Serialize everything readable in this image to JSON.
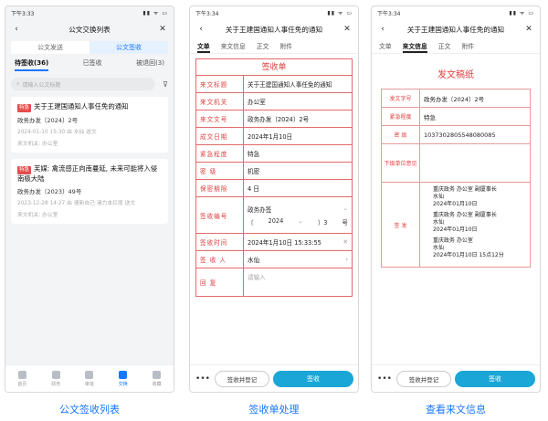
{
  "status": {
    "time_p1": "下午3:33",
    "time_p2": "下午3:34",
    "time_p3": "下午3:34",
    "signal": "▮▮ ᯤ ▭"
  },
  "p1": {
    "title": "公文交换列表",
    "seg": [
      "公文发送",
      "公文签收"
    ],
    "subtabs": [
      "待签收(36)",
      "已签收",
      "被退回(3)"
    ],
    "search_placeholder": "请输入公文标题",
    "cards": [
      {
        "tag": "",
        "title": "关于王建国通知人事任免的通知",
        "no": "政务办发〔2024〕2号",
        "meta": "2024-01-10 15:30 由 水仙 送文",
        "org": "来文机关: 办公室"
      },
      {
        "tag": "",
        "title": "关于王建国通知人事任免的通知",
        "no": "政务办发〔2024〕2号",
        "meta": "2024-01-10 15:30 由 水仙 送文",
        "org": "来文机关: 办公室"
      }
    ],
    "card1": {
      "tag": "特急",
      "title": "关于王建国通知人事任免的通知",
      "no": "政务办发〔2024〕2号",
      "meta": "2024-01-10 15:30 由 水仙 送文",
      "org": "来文机关: 办公室"
    },
    "card2": {
      "tag": "特急",
      "title": "芙媒: 禽流感正向南蔓延, 未来可能将入侵南极大陆",
      "no": "政务办发〔2023〕49号",
      "meta": "2023-12-28 14:27 由 速新自己·请力本扛揽 送文",
      "org": "来文机关: 办公室"
    },
    "tabbar": [
      "首页",
      "政务",
      "审批",
      "交换",
      "收藏"
    ]
  },
  "p2": {
    "title": "关于王建国通知人事任免的通知",
    "tabs": [
      "文单",
      "来文信息",
      "正文",
      "附件"
    ],
    "form_title": "签收单",
    "rows": {
      "title_k": "来文标题",
      "title_v": "关于王建国通知人事任免的通知",
      "org_k": "来文机关",
      "org_v": "办公室",
      "no_k": "来文文号",
      "no_v": "政务办发〔2024〕2号",
      "date_k": "成文日期",
      "date_v": "2024年1月10日",
      "urg_k": "紧急程度",
      "urg_v": "特急",
      "sec_k": "密  级",
      "sec_v": "机密",
      "term_k": "保密期限",
      "term_v": "4 日",
      "sn_k": "签收编号",
      "sn_a": "政务办签",
      "sn_b": "〔",
      "sn_year": "2024",
      "sn_c": "〕3",
      "sn_d": "号",
      "st_k": "签收时间",
      "st_v": "2024年1月10日 15:33:55",
      "sp_k": "签 收 人",
      "sp_v": "水仙",
      "rp_k": "回  复",
      "rp_ph": "请输入"
    },
    "more": "•••",
    "reg": "签收并登记",
    "sign": "签收"
  },
  "p3": {
    "title": "关于王建国通知人事任免的通知",
    "tabs": [
      "文单",
      "来文信息",
      "正文",
      "附件"
    ],
    "form_title": "发文稿纸",
    "rows": {
      "no_k": "发文字号",
      "no_v": "政务办发〔2024〕2号",
      "urg_k": "紧急程度",
      "urg_v": "特急",
      "sec_k": "密  级",
      "sec_v": "1037302805548080085",
      "opin_k": "下级单位意见",
      "opin_v": "",
      "sign_k": "签  发"
    },
    "sign1": {
      "org": "重庆政务 办公室 副厦事长",
      "name": "水仙",
      "date": "2024年01月10日"
    },
    "sign2": {
      "org": "重庆政务 办公室 副厦事长",
      "name": "水仙",
      "date": "2024年01月10日"
    },
    "sign3": {
      "org": "重庆政务 办公室",
      "name": "水仙",
      "date": "2024年01月10日 15点12分"
    },
    "more": "•••",
    "reg": "签收并登记",
    "sign": "签收"
  },
  "captions": [
    "公文签收列表",
    "签收单处理",
    "查看来文信息"
  ]
}
